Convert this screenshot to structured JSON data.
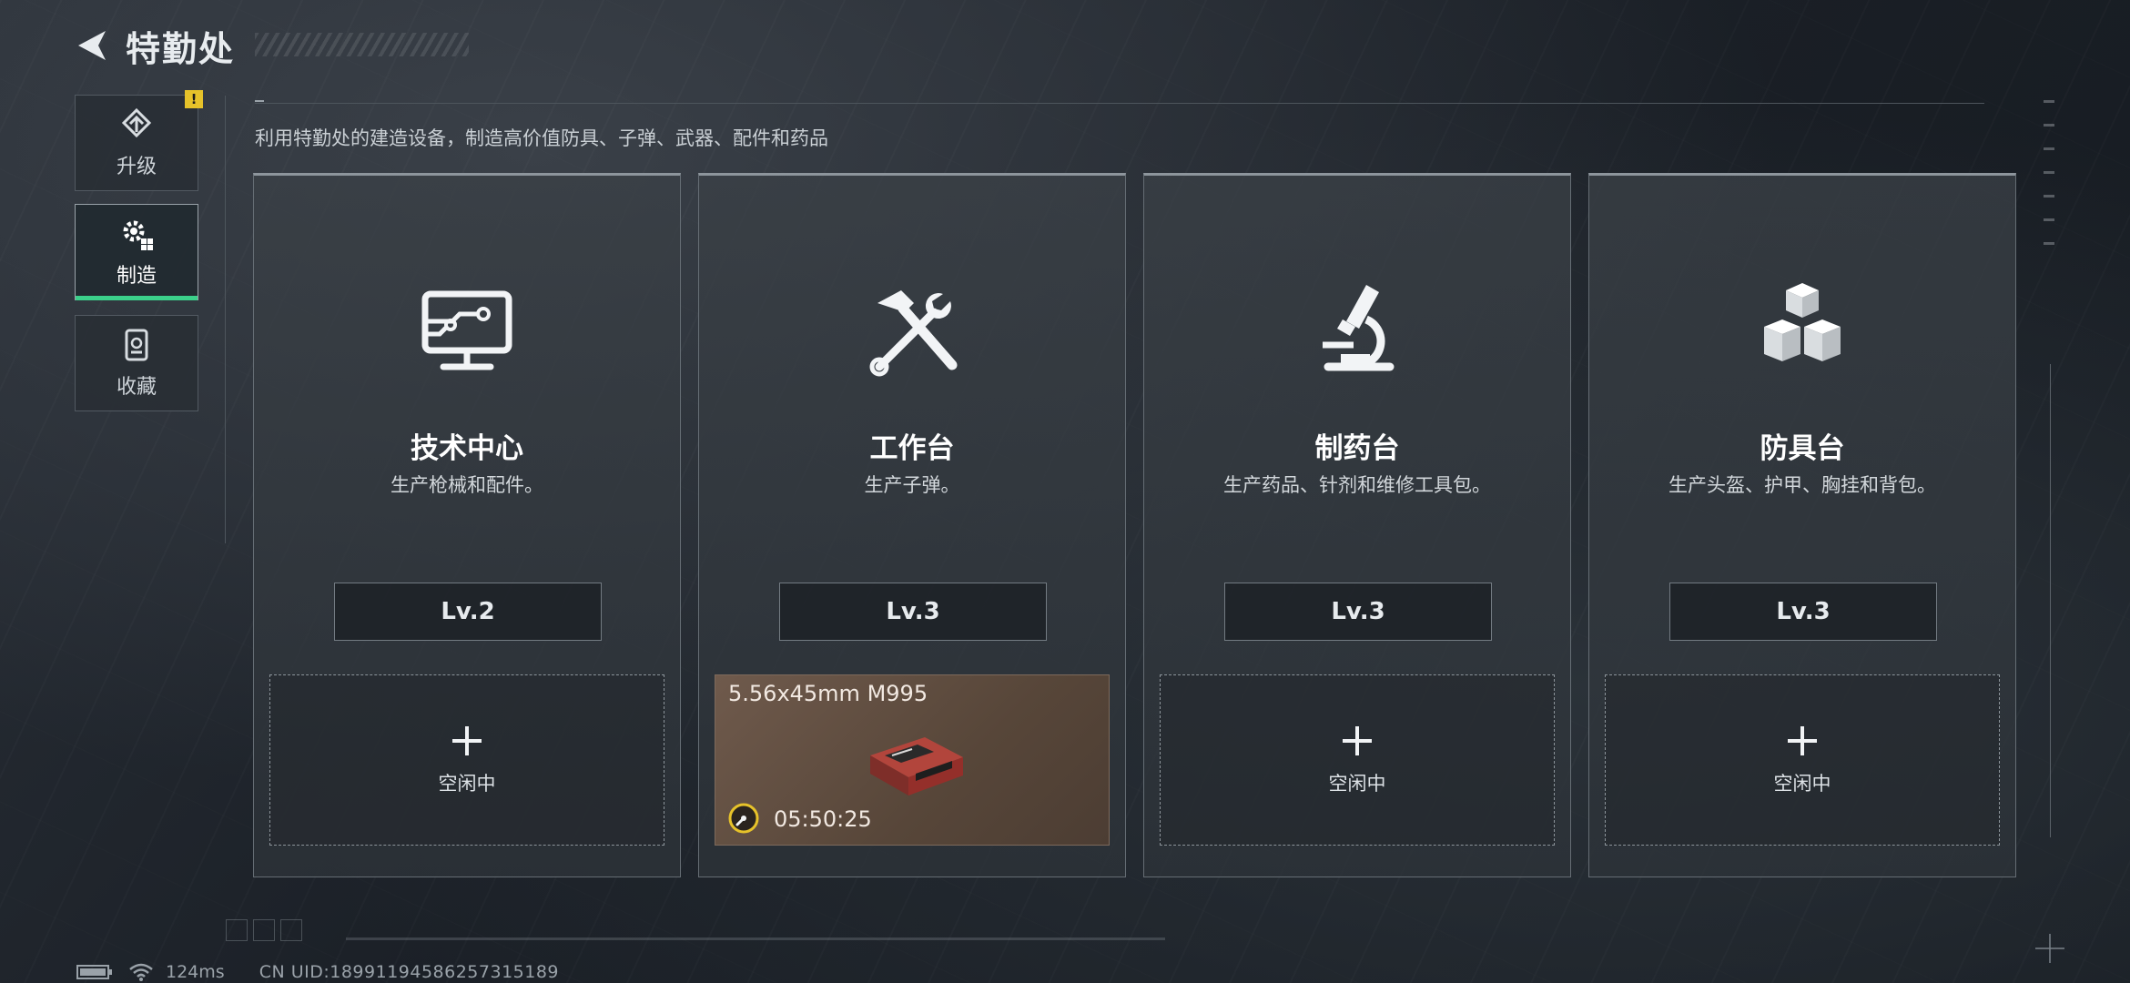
{
  "header": {
    "title": "特勤处"
  },
  "nav": {
    "items": [
      {
        "label": "升级",
        "alert": "!"
      },
      {
        "label": "制造"
      },
      {
        "label": "收藏"
      }
    ]
  },
  "subtitle": "利用特勤处的建造设备，制造高价值防具、子弹、武器、配件和药品",
  "cards": [
    {
      "title": "技术中心",
      "desc": "生产枪械和配件。",
      "level": "Lv.2",
      "slot_label": "空闲中",
      "icon": "monitor-circuit-icon"
    },
    {
      "title": "工作台",
      "desc": "生产子弹。",
      "level": "Lv.3",
      "slot_item": "5.56x45mm M995",
      "slot_timer": "05:50:25",
      "icon": "hammer-wrench-icon"
    },
    {
      "title": "制药台",
      "desc": "生产药品、针剂和维修工具包。",
      "level": "Lv.3",
      "slot_label": "空闲中",
      "icon": "microscope-icon"
    },
    {
      "title": "防具台",
      "desc": "生产头盔、护甲、胸挂和背包。",
      "level": "Lv.3",
      "slot_label": "空闲中",
      "icon": "cubes-icon"
    }
  ],
  "footer": {
    "ping": "124ms",
    "uid": "CN UID:18991194586257315189"
  },
  "colors": {
    "accent": "#3bd08a",
    "alert": "#e6c22a",
    "busy_slot": "#6f5a4c"
  }
}
